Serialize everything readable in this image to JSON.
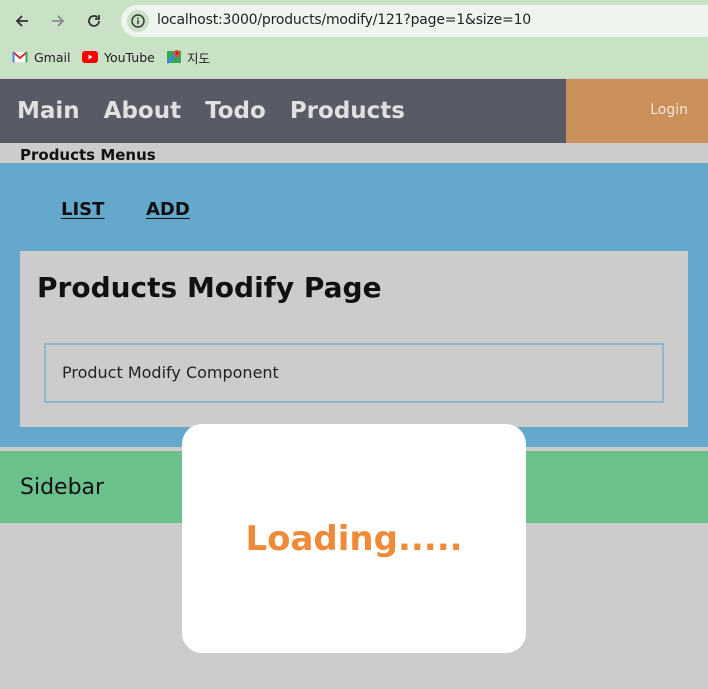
{
  "browser": {
    "url": "localhost:3000/products/modify/121?page=1&size=10",
    "bookmarks": [
      {
        "label": "Gmail",
        "icon": "gmail-icon"
      },
      {
        "label": "YouTube",
        "icon": "youtube-icon"
      },
      {
        "label": "지도",
        "icon": "maps-icon"
      }
    ]
  },
  "header": {
    "nav": [
      "Main",
      "About",
      "Todo",
      "Products"
    ],
    "login_label": "Login"
  },
  "products_menu": {
    "title": "Products Menus",
    "links": [
      "LIST",
      "ADD"
    ]
  },
  "page": {
    "title": "Products Modify Page",
    "component_label": "Product Modify Component"
  },
  "sidebar": {
    "label": "Sidebar"
  },
  "loading": {
    "text": "Loading....."
  },
  "colors": {
    "browser_bar": "#c9e2c6",
    "header": "#585b66",
    "login": "#cb915a",
    "blue_section": "#64a8cb",
    "panel": "#cccccc",
    "sidebar": "#6ac18b",
    "loading_text": "#ee8a38"
  }
}
